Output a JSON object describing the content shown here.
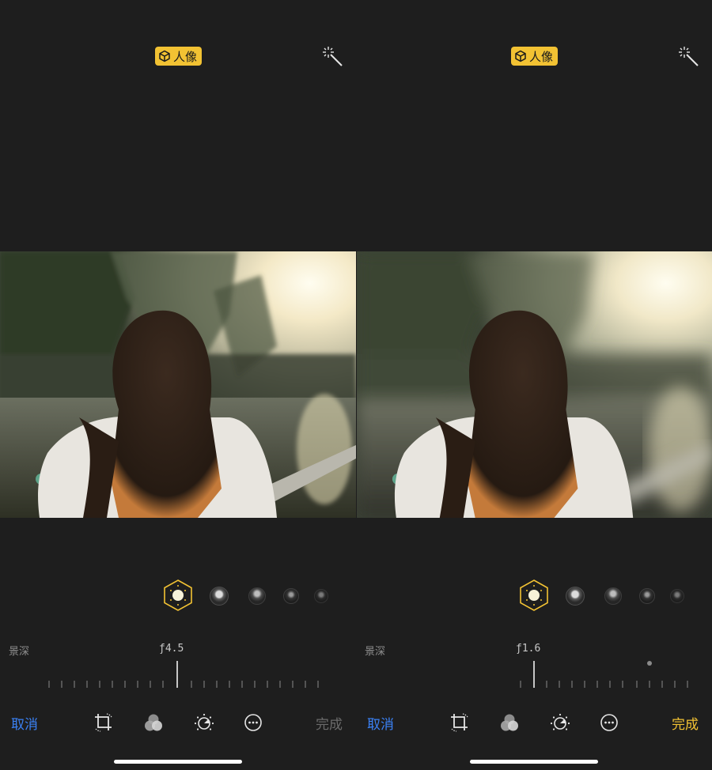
{
  "panels": [
    {
      "mode_badge": "人像",
      "depth_label": "景深",
      "f_value": "ƒ4.5",
      "cancel_label": "取消",
      "done_label": "完成",
      "done_color": "#6b6b6b",
      "slider_position": 0.48,
      "photo_blur": "light"
    },
    {
      "mode_badge": "人像",
      "depth_label": "景深",
      "f_value": "ƒ1.6",
      "cancel_label": "取消",
      "done_label": "完成",
      "done_color": "#f2c233",
      "slider_position": 0.05,
      "photo_blur": "heavy"
    }
  ],
  "icons": {
    "badge": "cube-icon",
    "wand": "magic-wand-icon",
    "lighting_selected": "natural-light-icon",
    "tools": [
      "crop-rotate-icon",
      "filters-icon",
      "adjust-icon",
      "more-icon"
    ]
  },
  "colors": {
    "accent": "#f2c233",
    "cancel": "#3b82f6",
    "background": "#1e1e1e"
  }
}
